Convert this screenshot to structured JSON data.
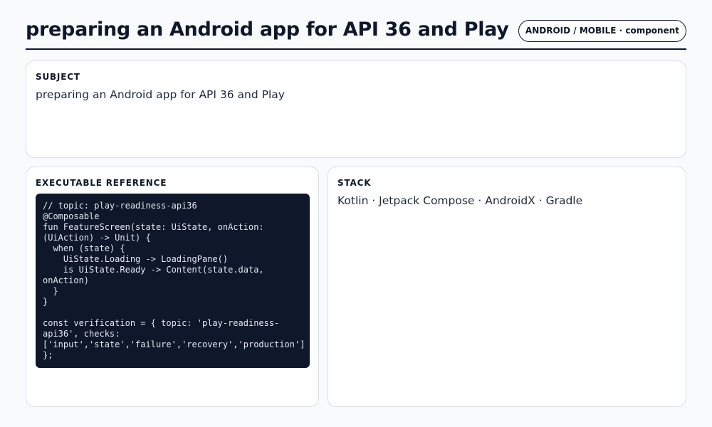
{
  "header": {
    "title": "preparing an Android app for API 36 and Play",
    "badge": "ANDROID / MOBILE · component"
  },
  "subject": {
    "label": "SUBJECT",
    "text": "preparing an Android app for API 36 and Play"
  },
  "reference": {
    "label": "EXECUTABLE REFERENCE",
    "code": "// topic: play-readiness-api36\n@Composable\nfun FeatureScreen(state: UiState, onAction:\n(UiAction) -> Unit) {\n  when (state) {\n    UiState.Loading -> LoadingPane()\n    is UiState.Ready -> Content(state.data,\nonAction)\n  }\n}\n\nconst verification = { topic: 'play-readiness-\napi36', checks:\n['input','state','failure','recovery','production']\n};"
  },
  "stack": {
    "label": "STACK",
    "text": "Kotlin · Jetpack Compose · AndroidX · Gradle"
  }
}
